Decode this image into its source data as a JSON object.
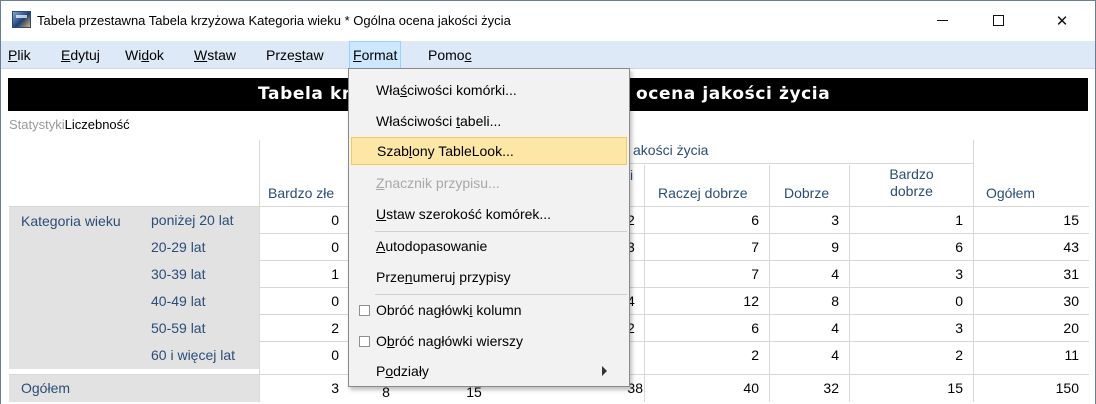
{
  "window": {
    "title": "Tabela przestawna Tabela krzyżowa Kategoria wieku * Ogólna ocena jakości życia",
    "minimize_glyph": "",
    "maximize_glyph": "",
    "close_glyph": "✕"
  },
  "menubar": {
    "items": [
      {
        "pre": "",
        "u": "P",
        "post": "lik"
      },
      {
        "pre": "",
        "u": "E",
        "post": "dytuj"
      },
      {
        "pre": "Wi",
        "u": "d",
        "post": "ok"
      },
      {
        "pre": "",
        "u": "W",
        "post": "staw"
      },
      {
        "pre": "Prze",
        "u": "s",
        "post": "taw"
      },
      {
        "pre": "",
        "u": "F",
        "post": "ormat"
      },
      {
        "pre": "Pomo",
        "u": "c",
        "post": ""
      }
    ]
  },
  "table": {
    "title_left": "Tabela krz",
    "title_right": "ocena jakości życia",
    "title_full": "Tabela krzyżowa Kategoria wieku * Ogólna ocena jakości życia",
    "stat_label": "Statystyki",
    "stat_value": "Liczebność",
    "group_header_partial": "akości życia",
    "col_fragment_i": "i",
    "columns": [
      "Bardzo złe",
      "Raczej dobrze",
      "Dobrze",
      "Bardzo\ndobrze",
      "Ogółem"
    ],
    "col_bardzo_dobrze_1": "Bardzo",
    "col_bardzo_dobrze_2": "dobrze",
    "row_group_label": "Kategoria wieku",
    "total_label": "Ogółem",
    "rows": [
      {
        "label": "poniżej 20 lat",
        "bardzo_zle": "0",
        "frag": "2",
        "raczej_dobrze": "6",
        "dobrze": "3",
        "bardzo_dobrze": "1",
        "ogolem": "15"
      },
      {
        "label": "20-29 lat",
        "bardzo_zle": "0",
        "frag": "3",
        "raczej_dobrze": "7",
        "dobrze": "9",
        "bardzo_dobrze": "6",
        "ogolem": "43"
      },
      {
        "label": "30-39 lat",
        "bardzo_zle": "1",
        "frag": "",
        "raczej_dobrze": "7",
        "dobrze": "4",
        "bardzo_dobrze": "3",
        "ogolem": "31"
      },
      {
        "label": "40-49 lat",
        "bardzo_zle": "0",
        "frag": "4",
        "raczej_dobrze": "12",
        "dobrze": "8",
        "bardzo_dobrze": "0",
        "ogolem": "30"
      },
      {
        "label": "50-59 lat",
        "bardzo_zle": "2",
        "frag": "2",
        "raczej_dobrze": "6",
        "dobrze": "4",
        "bardzo_dobrze": "3",
        "ogolem": "20"
      },
      {
        "label": "60 i więcej lat",
        "bardzo_zle": "0",
        "frag": "",
        "raczej_dobrze": "2",
        "dobrze": "4",
        "bardzo_dobrze": "2",
        "ogolem": "11"
      }
    ],
    "total_row": {
      "bardzo_zle": "3",
      "hidden_a": "8",
      "hidden_b": "15",
      "frag": "38",
      "raczej_dobrze": "40",
      "dobrze": "32",
      "bardzo_dobrze": "15",
      "ogolem": "150"
    }
  },
  "format_menu": {
    "items": [
      {
        "pre": "Wła",
        "u": "ś",
        "post": "ciwości komórki..."
      },
      {
        "pre": "Właściwości ",
        "u": "t",
        "post": "abeli..."
      },
      {
        "pre": "Szab",
        "u": "l",
        "post": "ony TableLook..."
      },
      {
        "pre": "",
        "u": "Z",
        "post": "nacznik przypisu..."
      },
      {
        "pre": "",
        "u": "U",
        "post": "staw szerokość komórek..."
      },
      {
        "pre": "",
        "u": "A",
        "post": "utodopasowanie"
      },
      {
        "pre": "Prze",
        "u": "n",
        "post": "umeruj przypisy"
      },
      {
        "pre": "Obróć nagłówk",
        "u": "i",
        "post": " kolumn"
      },
      {
        "pre": "O",
        "u": "b",
        "post": "róć nagłówki wierszy"
      },
      {
        "pre": "P",
        "u": "o",
        "post": "działy"
      }
    ]
  }
}
